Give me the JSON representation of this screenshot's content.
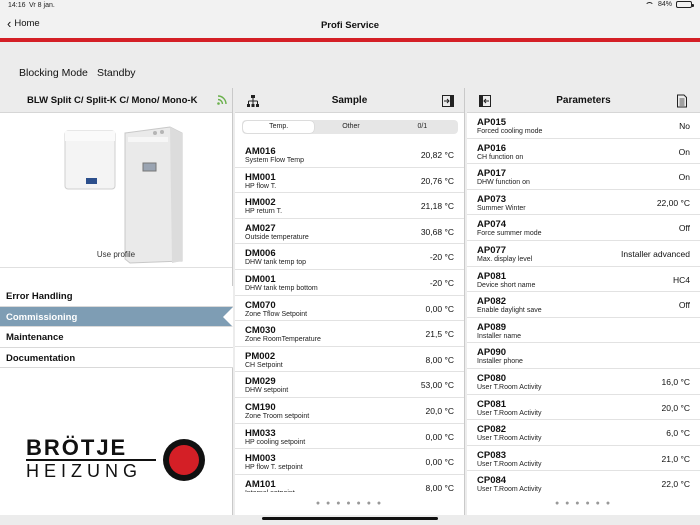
{
  "statusbar": {
    "time": "14:16",
    "date": "Vr 8 jan.",
    "battery": "84%"
  },
  "nav": {
    "back_label": "Home",
    "title": "Profi Service"
  },
  "mode": {
    "label": "Blocking Mode",
    "value": "Standby"
  },
  "left": {
    "title": "BLW Split C/ Split-K C/ Mono/ Mono-K",
    "use_profile": "Use profile",
    "menu": [
      "Error Handling",
      "Commissioning",
      "Maintenance",
      "Documentation"
    ],
    "active_index": 1,
    "logo_line1": "BRÖTJE",
    "logo_line2": "HEIZUNG"
  },
  "sample": {
    "title": "Sample",
    "tabs": [
      "Temp.",
      "Other",
      "0/1"
    ],
    "rows": [
      {
        "code": "AM016",
        "desc": "System Flow Temp",
        "value": "20,82 °C"
      },
      {
        "code": "HM001",
        "desc": "HP flow T.",
        "value": "20,76 °C"
      },
      {
        "code": "HM002",
        "desc": "HP return T.",
        "value": "21,18 °C"
      },
      {
        "code": "AM027",
        "desc": "Outside temperature",
        "value": "30,68 °C"
      },
      {
        "code": "DM006",
        "desc": "DHW tank temp top",
        "value": "-20 °C"
      },
      {
        "code": "DM001",
        "desc": "DHW tank temp bottom",
        "value": "-20 °C"
      },
      {
        "code": "CM070",
        "desc": "Zone Tflow Setpoint",
        "value": "0,00 °C"
      },
      {
        "code": "CM030",
        "desc": "Zone RoomTemperature",
        "value": "21,5 °C"
      },
      {
        "code": "PM002",
        "desc": "CH Setpoint",
        "value": "8,00 °C"
      },
      {
        "code": "DM029",
        "desc": "DHW setpoint",
        "value": "53,00 °C"
      },
      {
        "code": "CM190",
        "desc": "Zone Troom setpoint",
        "value": "20,0 °C"
      },
      {
        "code": "HM033",
        "desc": "HP cooling setpoint",
        "value": "0,00 °C"
      },
      {
        "code": "HM003",
        "desc": "HP flow T. setpoint",
        "value": "0,00 °C"
      },
      {
        "code": "AM101",
        "desc": "Internal setpoint",
        "value": "8,00 °C"
      }
    ],
    "dots": "● ● ● ● ● ● ●"
  },
  "params": {
    "title": "Parameters",
    "rows": [
      {
        "code": "AP015",
        "desc": "Forced cooling mode",
        "value": "No"
      },
      {
        "code": "AP016",
        "desc": "CH function on",
        "value": "On"
      },
      {
        "code": "AP017",
        "desc": "DHW function on",
        "value": "On"
      },
      {
        "code": "AP073",
        "desc": "Summer Winter",
        "value": "22,00 °C"
      },
      {
        "code": "AP074",
        "desc": "Force summer mode",
        "value": "Off"
      },
      {
        "code": "AP077",
        "desc": "Max. display level",
        "value": "Installer advanced"
      },
      {
        "code": "AP081",
        "desc": "Device short name",
        "value": "HC4"
      },
      {
        "code": "AP082",
        "desc": "Enable daylight save",
        "value": "Off"
      },
      {
        "code": "AP089",
        "desc": "Installer name",
        "value": ""
      },
      {
        "code": "AP090",
        "desc": "Installer phone",
        "value": ""
      },
      {
        "code": "CP080",
        "desc": "User T.Room Activity",
        "value": "16,0 °C"
      },
      {
        "code": "CP081",
        "desc": "User T.Room Activity",
        "value": "20,0 °C"
      },
      {
        "code": "CP082",
        "desc": "User T.Room Activity",
        "value": "6,0 °C"
      },
      {
        "code": "CP083",
        "desc": "User T.Room Activity",
        "value": "21,0 °C"
      },
      {
        "code": "CP084",
        "desc": "User T.Room Activity",
        "value": "22,0 °C"
      }
    ],
    "dots": "● ● ● ● ● ●"
  },
  "colors": {
    "accent_red": "#d41f26",
    "active_menu": "#7e9db4",
    "rss_green": "#6ab04c"
  }
}
